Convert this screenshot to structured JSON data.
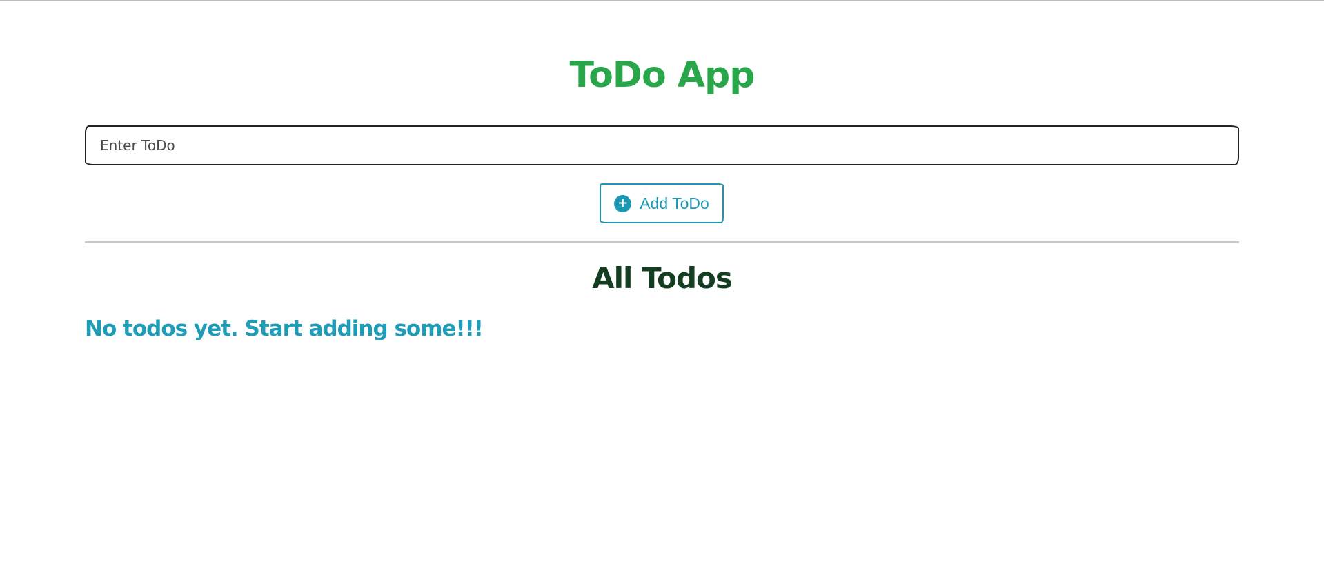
{
  "app": {
    "title": "ToDo App"
  },
  "form": {
    "input_value": "",
    "input_placeholder": "Enter ToDo",
    "add_button_label": "Add ToDo",
    "add_button_icon": "plus-circle-icon"
  },
  "list": {
    "heading": "All Todos",
    "empty_message": "No todos yet. Start adding some!!!",
    "items": []
  },
  "colors": {
    "title_green": "#2aa64a",
    "accent_teal": "#1c98b4",
    "heading_dark_green": "#143d22",
    "empty_text_teal": "#1f9db7"
  }
}
